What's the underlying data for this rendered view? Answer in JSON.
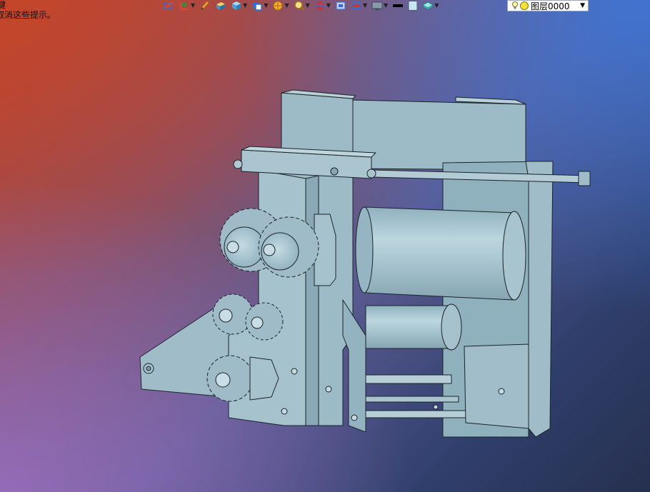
{
  "hint": {
    "line1": "键",
    "line2": "取消这些提示。"
  },
  "toolbar": {
    "buttons": [
      {
        "name": "line-icon",
        "color": "#d64a3a",
        "has_dropdown": false
      },
      {
        "name": "ucs-icon",
        "color": "#3a8a3a",
        "has_dropdown": true
      },
      {
        "name": "pen-icon",
        "color": "#e0a020",
        "has_dropdown": false
      },
      {
        "name": "solid-box-icon",
        "color": "#e0b030",
        "has_dropdown": false
      },
      {
        "name": "cube-icon",
        "color": "#4aa0d8",
        "has_dropdown": true
      },
      {
        "name": "copy-icon",
        "color": "#3a6ad0",
        "has_dropdown": true
      },
      {
        "name": "hatch-icon",
        "color": "#e09020",
        "has_dropdown": true
      },
      {
        "name": "zoom-icon",
        "color": "#d0a020",
        "has_dropdown": true
      },
      {
        "name": "orbit-icon",
        "color": "#d03030",
        "has_dropdown": true
      },
      {
        "name": "view-icon",
        "color": "#3a6ad0",
        "has_dropdown": false
      },
      {
        "name": "section-icon",
        "color": "#d03030",
        "has_dropdown": true
      },
      {
        "name": "display-icon",
        "color": "#5a6a7a",
        "has_dropdown": true
      },
      {
        "name": "lineweight-icon",
        "color": "#000000",
        "has_dropdown": false
      },
      {
        "name": "color-swatch-icon",
        "color": "#c8e4f4",
        "has_dropdown": false
      },
      {
        "name": "layer-tool-icon",
        "color": "#3aa0a0",
        "has_dropdown": true
      }
    ]
  },
  "layer": {
    "current": "图层0000"
  },
  "colors": {
    "model_face": "#9fbcc8",
    "model_face_light": "#b4cfd9",
    "model_edge": "#1b2328"
  }
}
